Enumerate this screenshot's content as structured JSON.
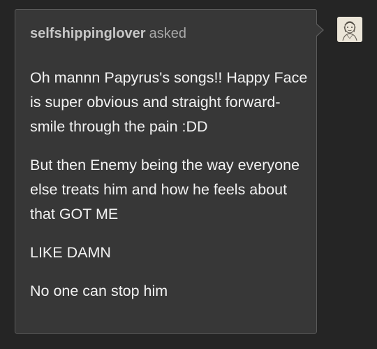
{
  "ask": {
    "asker_name": "selfshippinglover",
    "asked_label": "asked",
    "paragraphs": [
      "Oh mannn Papyrus's songs!! Happy Face is super obvious and straight forward-smile through the pain :DD",
      "But then Enemy being the way everyone else treats him and how he feels about that GOT ME",
      "LIKE DAMN",
      "No one can stop him"
    ]
  },
  "colors": {
    "page_background": "#252525",
    "bubble_background": "#373737",
    "bubble_border": "#5a5a5a",
    "body_text": "#f2f2f2",
    "header_text": "#bdbdbd"
  },
  "icons": {
    "avatar": "user-avatar-sketch"
  }
}
